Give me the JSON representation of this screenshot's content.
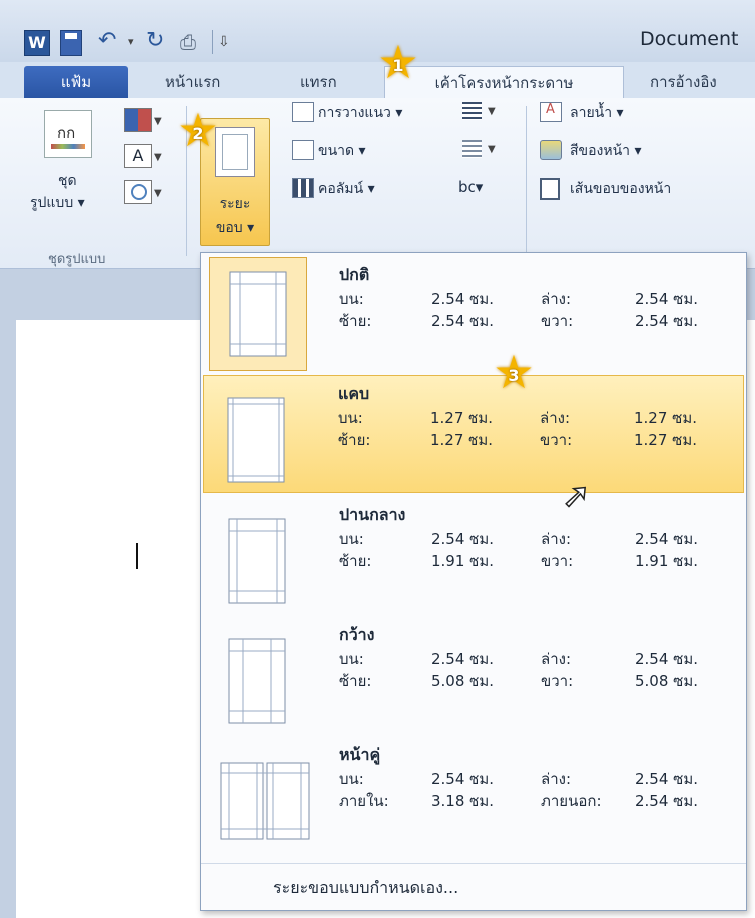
{
  "window": {
    "doc_title": "Document"
  },
  "tabs": [
    {
      "label": "แฟ้ม"
    },
    {
      "label": "หน้าแรก"
    },
    {
      "label": "แทรก"
    },
    {
      "label": "เค้าโครงหน้ากระดาษ"
    },
    {
      "label": "การอ้างอิง"
    }
  ],
  "ribbon": {
    "themes_label_1": "ชุด",
    "themes_label_2": "รูปแบบ ▾",
    "themes_group_label": "ชุดรูปแบบ",
    "margins_label_1": "ระยะ",
    "margins_label_2": "ขอบ ▾",
    "orientation": "การวางแนว ▾",
    "size": "ขนาด ▾",
    "columns": "คอลัมน์ ▾",
    "hyphenation": "bc▾",
    "watermark": "ลายน้ำ ▾",
    "page_color": "สีของหน้า ▾",
    "page_borders": "เส้นขอบของหน้า"
  },
  "margin_options": [
    {
      "name": "ปกติ",
      "r1": [
        "บน:",
        "2.54 ซม.",
        "ล่าง:",
        "2.54 ซม."
      ],
      "r2": [
        "ซ้าย:",
        "2.54 ซม.",
        "ขวา:",
        "2.54 ซม."
      ]
    },
    {
      "name": "แคบ",
      "r1": [
        "บน:",
        "1.27 ซม.",
        "ล่าง:",
        "1.27 ซม."
      ],
      "r2": [
        "ซ้าย:",
        "1.27 ซม.",
        "ขวา:",
        "1.27 ซม."
      ]
    },
    {
      "name": "ปานกลาง",
      "r1": [
        "บน:",
        "2.54 ซม.",
        "ล่าง:",
        "2.54 ซม."
      ],
      "r2": [
        "ซ้าย:",
        "1.91 ซม.",
        "ขวา:",
        "1.91 ซม."
      ]
    },
    {
      "name": "กว้าง",
      "r1": [
        "บน:",
        "2.54 ซม.",
        "ล่าง:",
        "2.54 ซม."
      ],
      "r2": [
        "ซ้าย:",
        "5.08 ซม.",
        "ขวา:",
        "5.08 ซม."
      ]
    },
    {
      "name": "หน้าคู่",
      "r1": [
        "บน:",
        "2.54 ซม.",
        "ล่าง:",
        "2.54 ซม."
      ],
      "r2": [
        "ภายใน:",
        "3.18 ซม.",
        "ภายนอก:",
        "2.54 ซม."
      ]
    }
  ],
  "custom_margins": "ระยะขอบแบบกำหนดเอง...",
  "callouts": [
    "1",
    "2",
    "3"
  ],
  "colors": {
    "accent_yellow": "#fcd978",
    "file_tab": "#2a55a4"
  }
}
